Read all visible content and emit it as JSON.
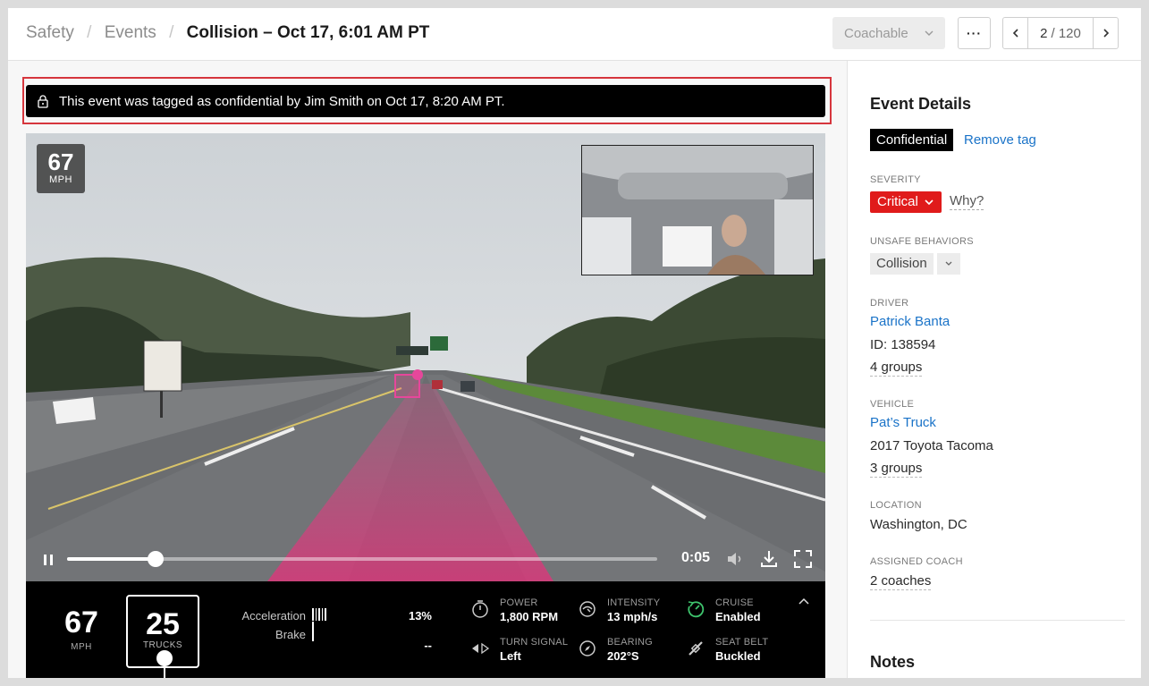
{
  "breadcrumb": {
    "items": [
      "Safety",
      "Events"
    ],
    "current": "Collision – Oct 17, 6:01 AM PT"
  },
  "toolbar": {
    "coachable_label": "Coachable",
    "more_label": "···",
    "pager": {
      "current": "2",
      "total": "/ 120"
    }
  },
  "banner": {
    "text": "This event was tagged as confidential by Jim Smith on Oct 17, 8:20 AM PT."
  },
  "video": {
    "speed_badge": {
      "value": "67",
      "unit": "MPH"
    },
    "progress": 0.15,
    "time": "0:05",
    "telemetry": {
      "speed": {
        "value": "67",
        "unit": "MPH"
      },
      "speed_limit": {
        "value": "25",
        "unit": "TRUCKS"
      },
      "acceleration_label": "Acceleration",
      "brake_label": "Brake",
      "acceleration_value": "13%",
      "brake_value": "--",
      "power": {
        "label": "POWER",
        "value": "1,800 RPM"
      },
      "intensity": {
        "label": "INTENSITY",
        "value": "13 mph/s"
      },
      "cruise": {
        "label": "CRUISE",
        "value": "Enabled"
      },
      "turn_signal": {
        "label": "TURN SIGNAL",
        "value": "Left"
      },
      "bearing": {
        "label": "BEARING",
        "value": "202°S"
      },
      "seat_belt": {
        "label": "SEAT BELT",
        "value": "Buckled"
      }
    }
  },
  "details": {
    "title": "Event Details",
    "tag": "Confidential",
    "remove_tag": "Remove tag",
    "severity": {
      "label": "SEVERITY",
      "value": "Critical",
      "why": "Why?",
      "color": "#e01b1b"
    },
    "unsafe_behaviors": {
      "label": "UNSAFE BEHAVIORS",
      "value": "Collision"
    },
    "driver": {
      "label": "DRIVER",
      "name": "Patrick Banta",
      "id": "ID: 138594",
      "groups": "4 groups"
    },
    "vehicle": {
      "label": "VEHICLE",
      "name": "Pat’s Truck",
      "model": "2017 Toyota Tacoma",
      "groups": "3 groups"
    },
    "location": {
      "label": "LOCATION",
      "value": "Washington, DC"
    },
    "coach": {
      "label": "ASSIGNED COACH",
      "value": "2 coaches"
    },
    "notes_title": "Notes"
  },
  "colors": {
    "link": "#1a73c8",
    "highlight": "#d6363d",
    "cruise_icon": "#3ec46d"
  }
}
